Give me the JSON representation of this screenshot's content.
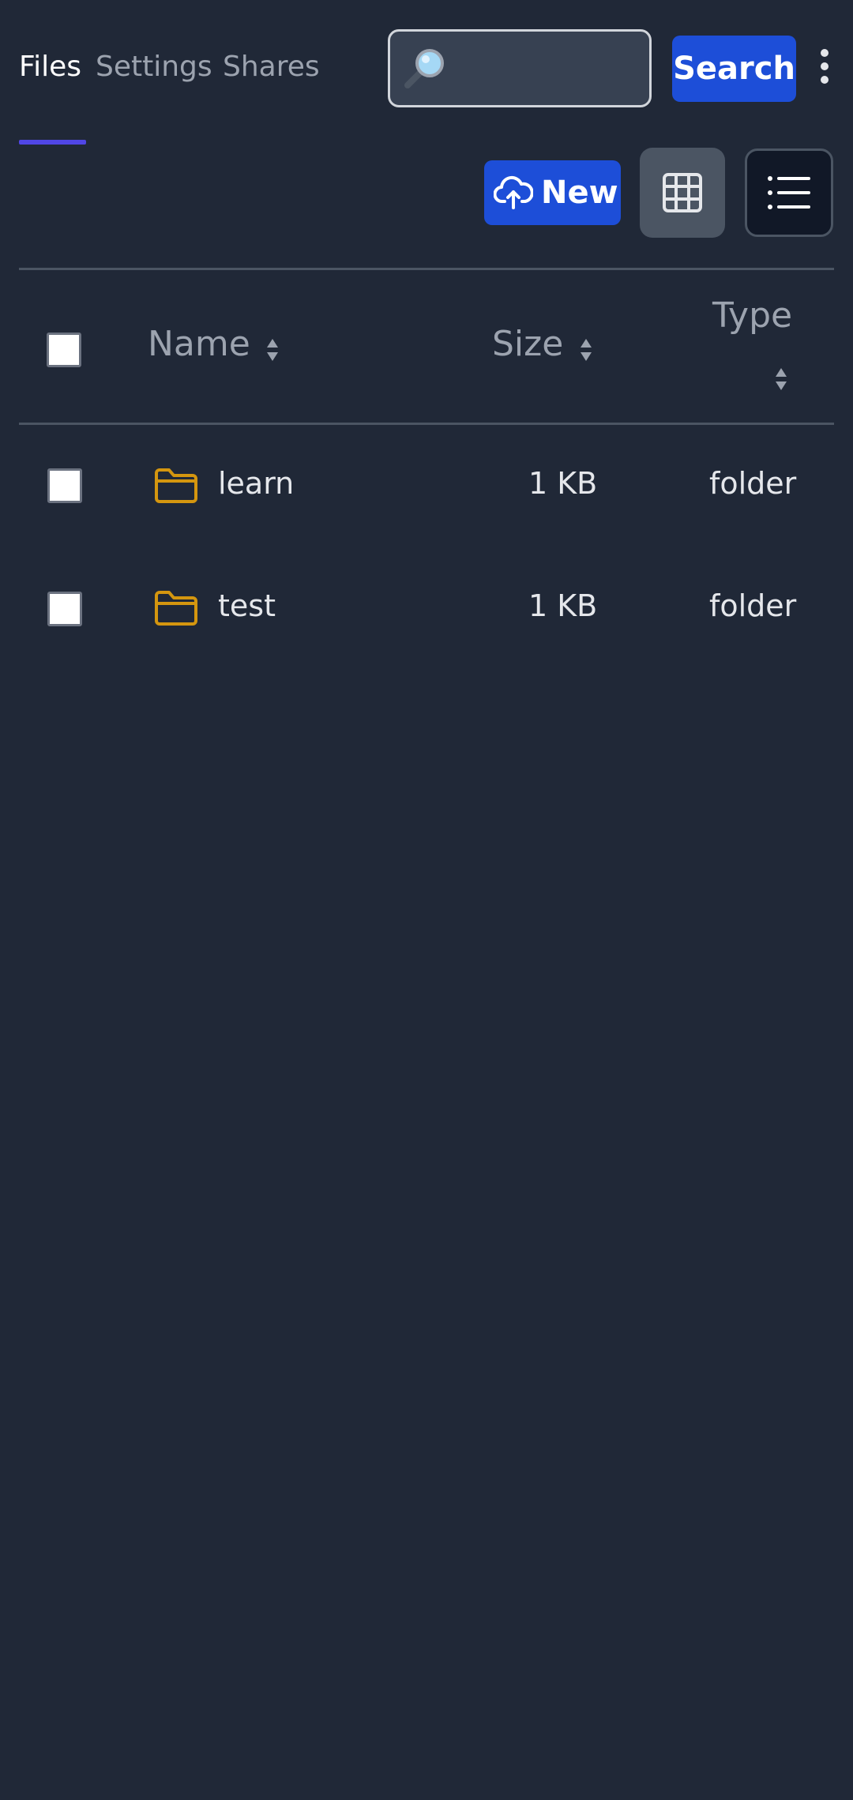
{
  "nav": {
    "tabs": [
      {
        "label": "Files",
        "active": true
      },
      {
        "label": "Settings",
        "active": false
      },
      {
        "label": "Shares",
        "active": false
      }
    ]
  },
  "search": {
    "value": "",
    "placeholder": "",
    "button_label": "Search"
  },
  "toolbar": {
    "new_label": "New",
    "view_mode": "list"
  },
  "table": {
    "columns": {
      "name": "Name",
      "size": "Size",
      "type": "Type"
    },
    "rows": [
      {
        "name": "learn",
        "size": "1 KB",
        "type": "folder",
        "icon": "folder-icon"
      },
      {
        "name": "test",
        "size": "1 KB",
        "type": "folder",
        "icon": "folder-icon"
      }
    ]
  },
  "colors": {
    "background": "#202837",
    "accent": "#1d4ed8",
    "tab_underline": "#5046e5",
    "folder": "#d4960f"
  }
}
